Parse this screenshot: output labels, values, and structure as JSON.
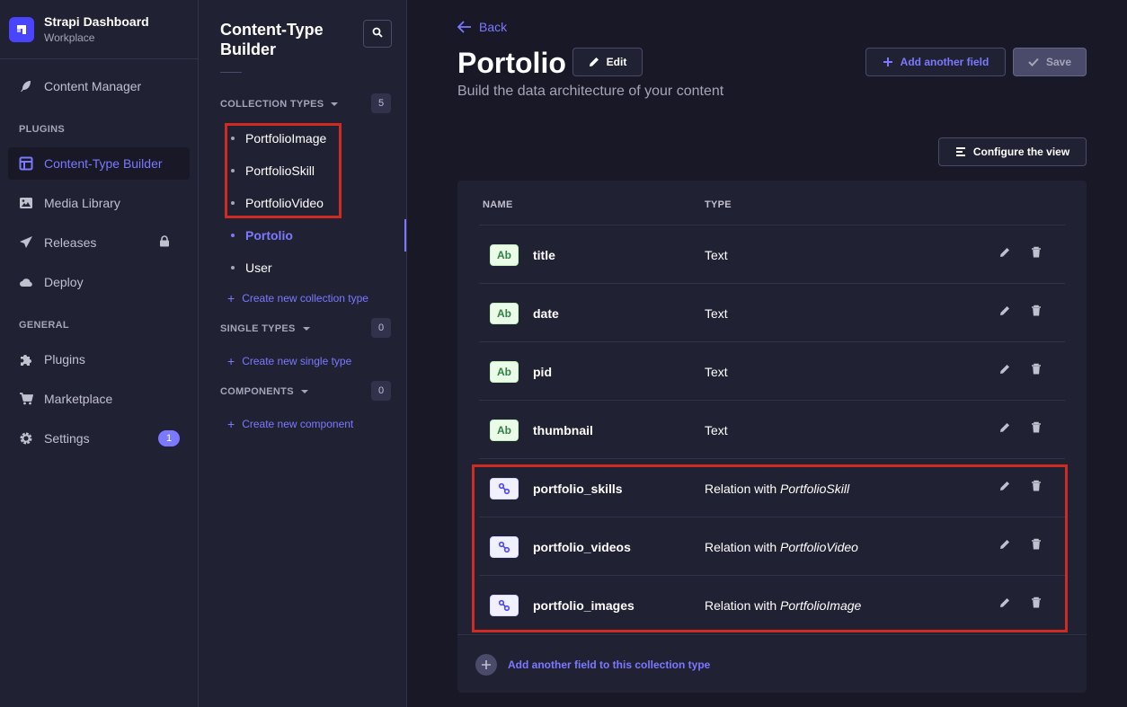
{
  "app": {
    "title": "Strapi Dashboard",
    "workspace": "Workplace"
  },
  "nav": {
    "content_manager": "Content Manager",
    "plugins_section": "PLUGINS",
    "content_type_builder": "Content-Type Builder",
    "media_library": "Media Library",
    "releases": "Releases",
    "deploy": "Deploy",
    "general_section": "GENERAL",
    "plugins": "Plugins",
    "marketplace": "Marketplace",
    "settings": "Settings",
    "settings_badge": "1"
  },
  "subnav": {
    "title": "Content-Type Builder",
    "collection_types_label": "COLLECTION TYPES",
    "collection_types_count": "5",
    "collection_types": [
      "PortfolioImage",
      "PortfolioSkill",
      "PortfolioVideo",
      "Portolio",
      "User"
    ],
    "create_collection": "Create new collection type",
    "single_types_label": "SINGLE TYPES",
    "single_types_count": "0",
    "create_single": "Create new single type",
    "components_label": "COMPONENTS",
    "components_count": "0",
    "create_component": "Create new component"
  },
  "header": {
    "back": "Back",
    "title": "Portolio",
    "edit": "Edit",
    "subtitle": "Build the data architecture of your content",
    "add_field": "Add another field",
    "save": "Save",
    "configure_view": "Configure the view"
  },
  "table": {
    "col_name": "NAME",
    "col_type": "TYPE",
    "rows": [
      {
        "icon": "Ab",
        "name": "title",
        "type": "Text",
        "relation_target": ""
      },
      {
        "icon": "Ab",
        "name": "date",
        "type": "Text",
        "relation_target": ""
      },
      {
        "icon": "Ab",
        "name": "pid",
        "type": "Text",
        "relation_target": ""
      },
      {
        "icon": "Ab",
        "name": "thumbnail",
        "type": "Text",
        "relation_target": ""
      },
      {
        "icon": "relation-icon",
        "name": "portfolio_skills",
        "type": "Relation with ",
        "relation_target": "PortfolioSkill"
      },
      {
        "icon": "relation-icon",
        "name": "portfolio_videos",
        "type": "Relation with ",
        "relation_target": "PortfolioVideo"
      },
      {
        "icon": "relation-icon",
        "name": "portfolio_images",
        "type": "Relation with ",
        "relation_target": "PortfolioImage"
      }
    ],
    "footer_add": "Add another field to this collection type"
  },
  "colors": {
    "accent": "#7b79ff",
    "primary": "#4945ff",
    "highlight_box": "#d02b20",
    "background": "#181826",
    "panel": "#212134"
  }
}
